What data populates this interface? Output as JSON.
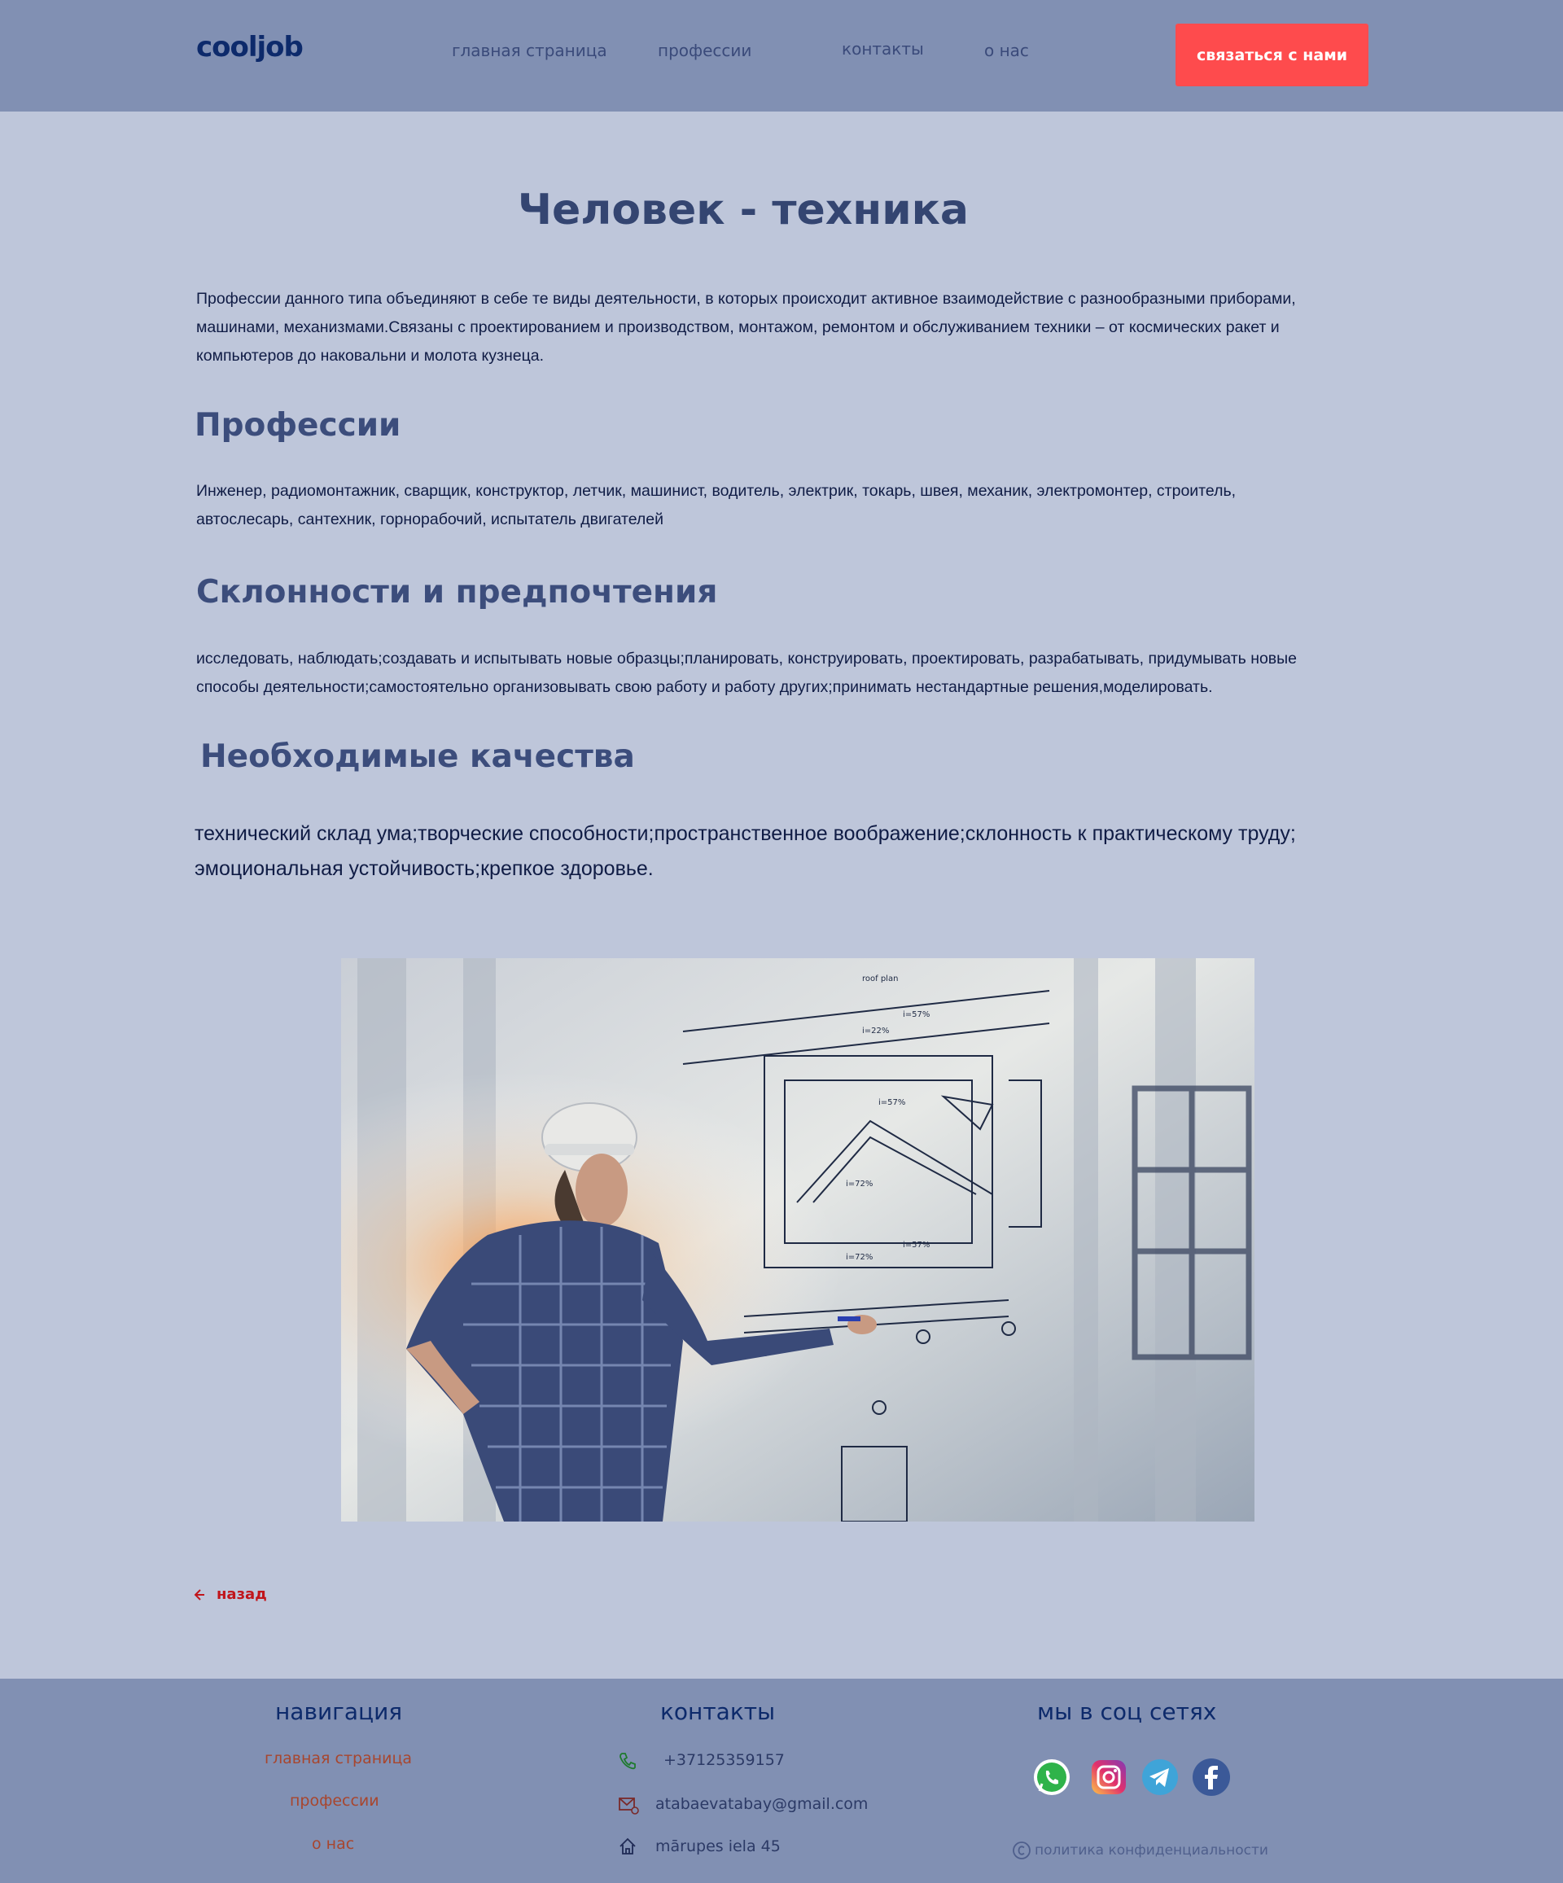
{
  "header": {
    "logo": "cooljob",
    "nav": [
      "главная страница",
      "профессии",
      "контакты",
      "о нас"
    ],
    "cta": "связаться с нами"
  },
  "main": {
    "title": "Человек - техника",
    "intro": "Профессии данного типа объединяют в себе те виды деятельности, в которых происходит активное взаимодействие с разнообразными приборами, машинами, механизмами.Связаны с проектированием и производством, монтажом, ремонтом и обслуживанием техники – от космических ракет и компьютеров до наковальни и молота кузнеца.",
    "sections": [
      {
        "heading": "Профессии",
        "text": "Инженер, радиомонтажник, сварщик, конструктор, летчик, машинист, водитель, электрик, токарь, швея, механик, электромонтер, строитель, автослесарь, сантехник, горнорабочий, испытатель двигателей"
      },
      {
        "heading": "Склонности и предпочтения",
        "text": "исследовать, наблюдать;создавать и испытывать новые образцы;планировать, конструировать, проектировать, разрабатывать, придумывать новые способы деятельности;самостоятельно организовывать свою работу и работу других;принимать нестандартные решения,моделировать."
      },
      {
        "heading": "Необходимые качества",
        "text": "технический склад ума;творческие способности;пространственное воображение;склонность к практическому труду; эмоциональная устойчивость;крепкое здоровье."
      }
    ],
    "back": "назад"
  },
  "footer": {
    "nav_title": "навигация",
    "nav_links": [
      "главная страница",
      "профессии",
      "о нас"
    ],
    "contacts_title": "контакты",
    "phone": "+37125359157",
    "email": "atabaevatabay@gmail.com",
    "address": "mārupes iela 45",
    "social_title": "мы в соц сетях",
    "social_icons": [
      "whatsapp-icon",
      "instagram-icon",
      "telegram-icon",
      "facebook-icon"
    ],
    "privacy": "политика конфиденциальности"
  },
  "colors": {
    "page_bg": "#bec6da",
    "header_bg": "#8190b3",
    "accent": "#fe4b4d",
    "heading": "#344571",
    "back_link": "#c1151b",
    "footer_link": "#a8462e"
  }
}
